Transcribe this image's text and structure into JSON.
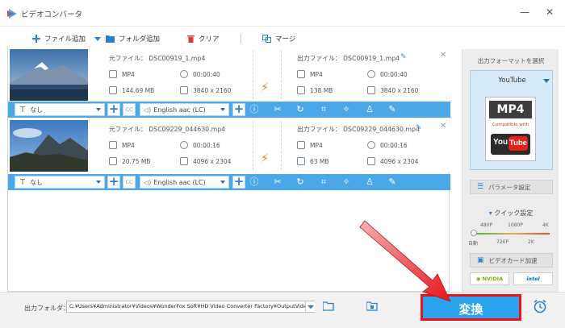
{
  "window": {
    "title": "ビデオコンバータ",
    "minimize_glyph": "—",
    "close_glyph": "✕"
  },
  "toolbar": {
    "add_file": "ファイル追加",
    "add_folder": "フォルダ追加",
    "clear": "クリア",
    "merge": "マージ"
  },
  "files": [
    {
      "source_name": "元ファイル： DSC00919_1.mp4",
      "output_name": "出力ファイル： DSC00919_1.mp4",
      "src_format": "MP4",
      "src_duration": "00:00:40",
      "src_size": "144.69 MB",
      "src_resolution": "3840 x 2160",
      "out_format": "MP4",
      "out_duration": "00:00:40",
      "out_size": "138 MB",
      "out_resolution": "3840 x 2160",
      "subtitle": "なし",
      "audio": "English aac (LC)"
    },
    {
      "source_name": "元ファイル： DSC09229_044630.mp4",
      "output_name": "出力ファイル： DSC09229_044630.mp4",
      "src_format": "MP4",
      "src_duration": "00:00:16",
      "src_size": "20.75 MB",
      "src_resolution": "4096 x 2304",
      "out_format": "MP4",
      "out_duration": "00:00:16",
      "out_size": "63 MB",
      "out_resolution": "4096 x 2304",
      "subtitle": "なし",
      "audio": "English aac (LC)"
    }
  ],
  "right_panel": {
    "format_title": "出力フォーマットを選択",
    "format_name": "YouTube",
    "format_badge": "MP4",
    "compat_text": "Compatible with",
    "yt_you": "You",
    "yt_tube": "Tube",
    "param_button": "パラメータ設定",
    "quick_label": "クイック設定",
    "quick_ticks_top": [
      "480P",
      "1080P",
      "4K"
    ],
    "quick_ticks_bottom": [
      "自動",
      "720P",
      "2K"
    ],
    "quick_level": 0.0,
    "gpu_label": "ビデオカード加速",
    "gpu_nvidia": "NVIDIA",
    "gpu_intel": "intel"
  },
  "bottom": {
    "output_folder_label": "出力フォルダ：",
    "output_path": "C:¥Users¥Administrator¥Videos¥WonderFox Soft¥HD Video Converter Factory¥OutputVideo¥",
    "convert_label": "変換"
  },
  "colors": {
    "accent_blue": "#4aa8e8",
    "convert_blue": "#2aa3ec",
    "annotation_red": "#e8141c",
    "bolt_orange": "#f07b1e"
  }
}
